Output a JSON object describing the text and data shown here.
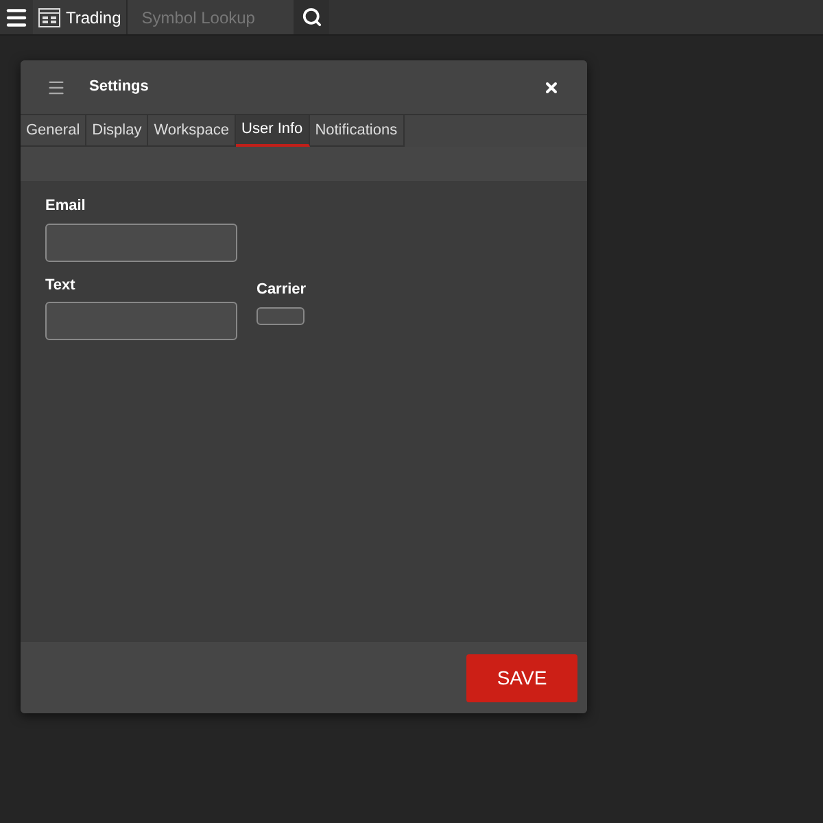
{
  "toolbar": {
    "app_label": "Trading",
    "search": {
      "placeholder": "Symbol Lookup"
    }
  },
  "dialog": {
    "title": "Settings",
    "tabs": [
      {
        "label": "General",
        "selected": false
      },
      {
        "label": "Display",
        "selected": false
      },
      {
        "label": "Workspace",
        "selected": false
      },
      {
        "label": "User Info",
        "selected": true
      },
      {
        "label": "Notifications",
        "selected": false
      }
    ],
    "fields": [
      {
        "label": "Email",
        "kind": "text"
      },
      {
        "label": "Text",
        "kind": "text"
      },
      {
        "label": "Carrier",
        "kind": "select"
      }
    ],
    "save_button": "SAVE"
  }
}
